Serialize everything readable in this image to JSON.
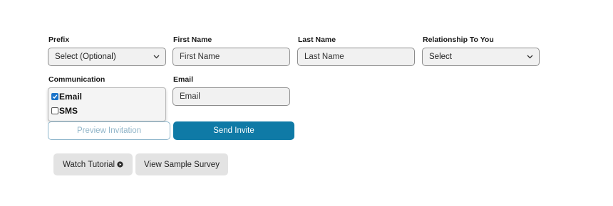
{
  "form": {
    "prefix": {
      "label": "Prefix",
      "selected": "Select (Optional)"
    },
    "first_name": {
      "label": "First Name",
      "placeholder": "First Name"
    },
    "last_name": {
      "label": "Last Name",
      "placeholder": "Last Name"
    },
    "relationship": {
      "label": "Relationship To You",
      "selected": "Select"
    },
    "communication": {
      "label": "Communication",
      "options": [
        {
          "label": "Email",
          "checked": true
        },
        {
          "label": "SMS",
          "checked": false
        }
      ]
    },
    "email": {
      "label": "Email",
      "placeholder": "Email"
    }
  },
  "actions": {
    "preview_label": "Preview Invitation",
    "send_label": "Send Invite"
  },
  "links": {
    "watch_tutorial_label": "Watch Tutorial",
    "view_sample_label": "View Sample Survey"
  },
  "colors": {
    "primary": "#0f7aa6",
    "preview_text": "#8fb4c8",
    "checkbox_checked": "#1a73c9"
  }
}
